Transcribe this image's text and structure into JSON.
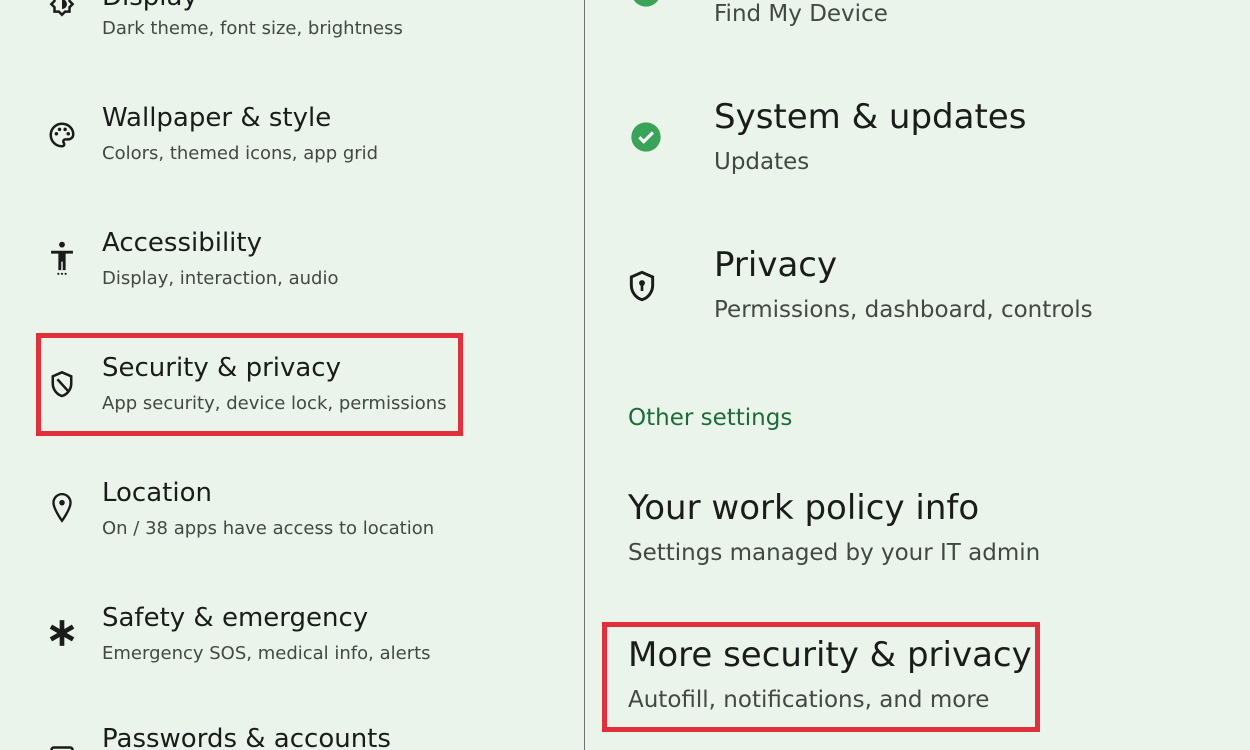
{
  "left_panel": {
    "items": [
      {
        "title": "Display",
        "subtitle": "Dark theme, font size, brightness",
        "icon": "brightness-icon"
      },
      {
        "title": "Wallpaper & style",
        "subtitle": "Colors, themed icons, app grid",
        "icon": "palette-icon"
      },
      {
        "title": "Accessibility",
        "subtitle": "Display, interaction, audio",
        "icon": "accessibility-icon"
      },
      {
        "title": "Security & privacy",
        "subtitle": "App security, device lock, permissions",
        "icon": "shield-icon"
      },
      {
        "title": "Location",
        "subtitle": "On / 38 apps have access to location",
        "icon": "location-pin-icon"
      },
      {
        "title": "Safety & emergency",
        "subtitle": "Emergency SOS, medical info, alerts",
        "icon": "asterisk-icon"
      },
      {
        "title": "Passwords & accounts",
        "subtitle": "",
        "icon": "account-box-icon"
      }
    ]
  },
  "right_panel": {
    "items": [
      {
        "title": "",
        "subtitle": "Find My Device",
        "icon": "check-circle-icon"
      },
      {
        "title": "System & updates",
        "subtitle": "Updates",
        "icon": "check-circle-icon"
      },
      {
        "title": "Privacy",
        "subtitle": "Permissions, dashboard, controls",
        "icon": "privacy-shield-icon"
      }
    ],
    "section_header": "Other settings",
    "other_items": [
      {
        "title": "Your work policy info",
        "subtitle": "Settings managed by your IT admin"
      },
      {
        "title": "More security & privacy",
        "subtitle": "Autofill, notifications, and more"
      }
    ]
  },
  "colors": {
    "background": "#eaf4eb",
    "highlight": "#e0303b",
    "check_green": "#3aa35a",
    "section_header": "#1d6b38"
  }
}
